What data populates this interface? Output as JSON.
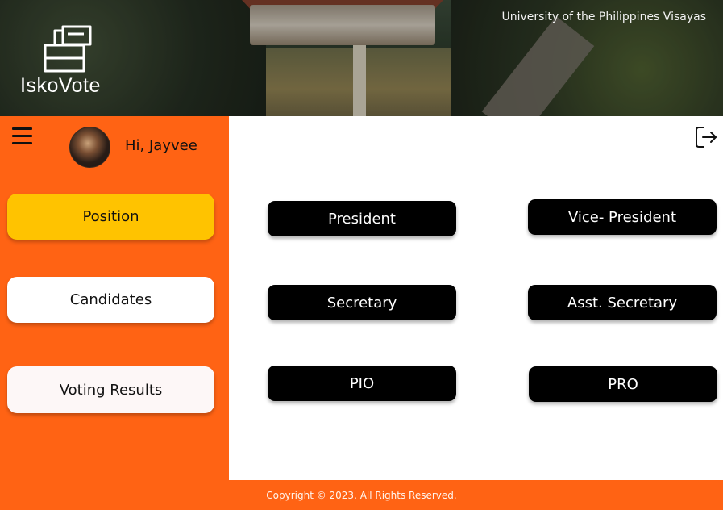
{
  "header": {
    "app_name": "IskoVote",
    "university": "University of the Philippines Visayas",
    "logo_icon": "ballot-box-icon"
  },
  "sidebar": {
    "menu_icon": "hamburger-menu-icon",
    "greeting": "Hi, Jayvee",
    "nav": [
      {
        "label": "Position",
        "active": true
      },
      {
        "label": "Candidates",
        "active": false
      },
      {
        "label": "Voting Results",
        "active": false
      }
    ]
  },
  "main": {
    "logout_icon": "logout-icon",
    "positions": [
      {
        "label": "President"
      },
      {
        "label": "Vice- President"
      },
      {
        "label": "Secretary"
      },
      {
        "label": "Asst. Secretary"
      },
      {
        "label": "PIO"
      },
      {
        "label": "PRO"
      }
    ]
  },
  "footer": {
    "copyright": "Copyright © 2023. All Rights Reserved."
  },
  "colors": {
    "accent": "#ff6314",
    "active_nav": "#ffc300",
    "position_button": "#000000"
  }
}
